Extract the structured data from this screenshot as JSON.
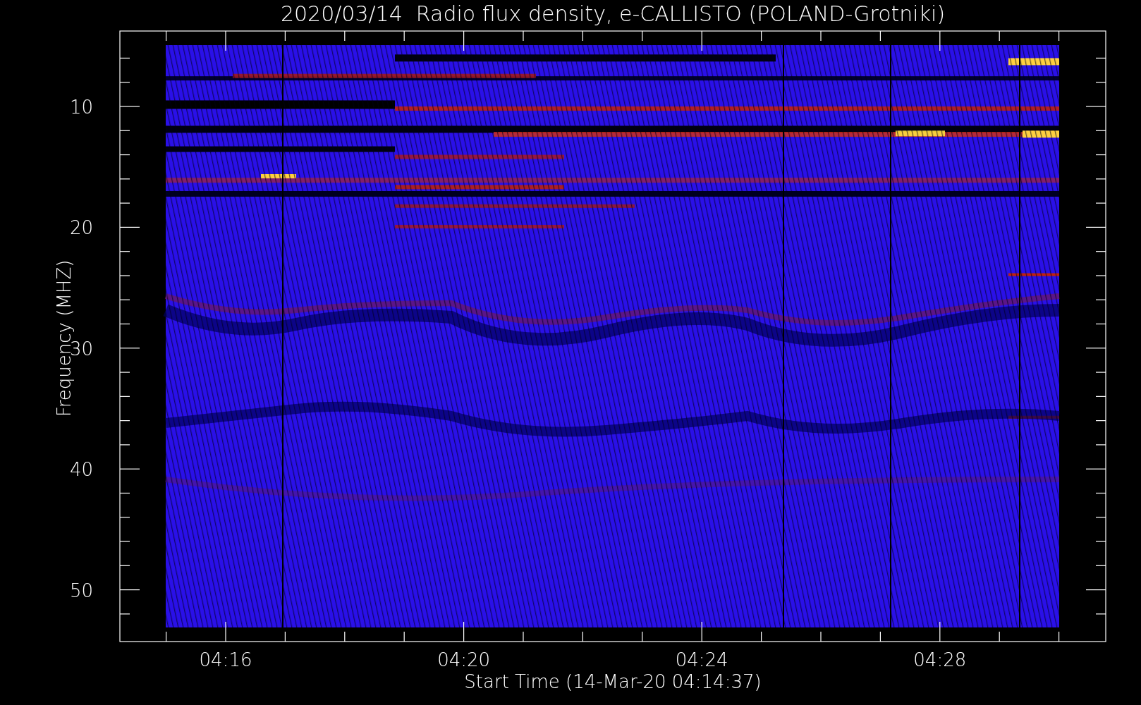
{
  "title": "2020/03/14  Radio flux density, e-CALLISTO (POLAND-Grotniki)",
  "y_axis": {
    "label": "Frequency (MHZ)",
    "ticks": [
      "10",
      "20",
      "30",
      "40",
      "50"
    ]
  },
  "x_axis": {
    "label": "Start Time (14-Mar-20 04:14:37)",
    "ticks": [
      "04:16",
      "04:20",
      "04:24",
      "04:28"
    ]
  }
}
